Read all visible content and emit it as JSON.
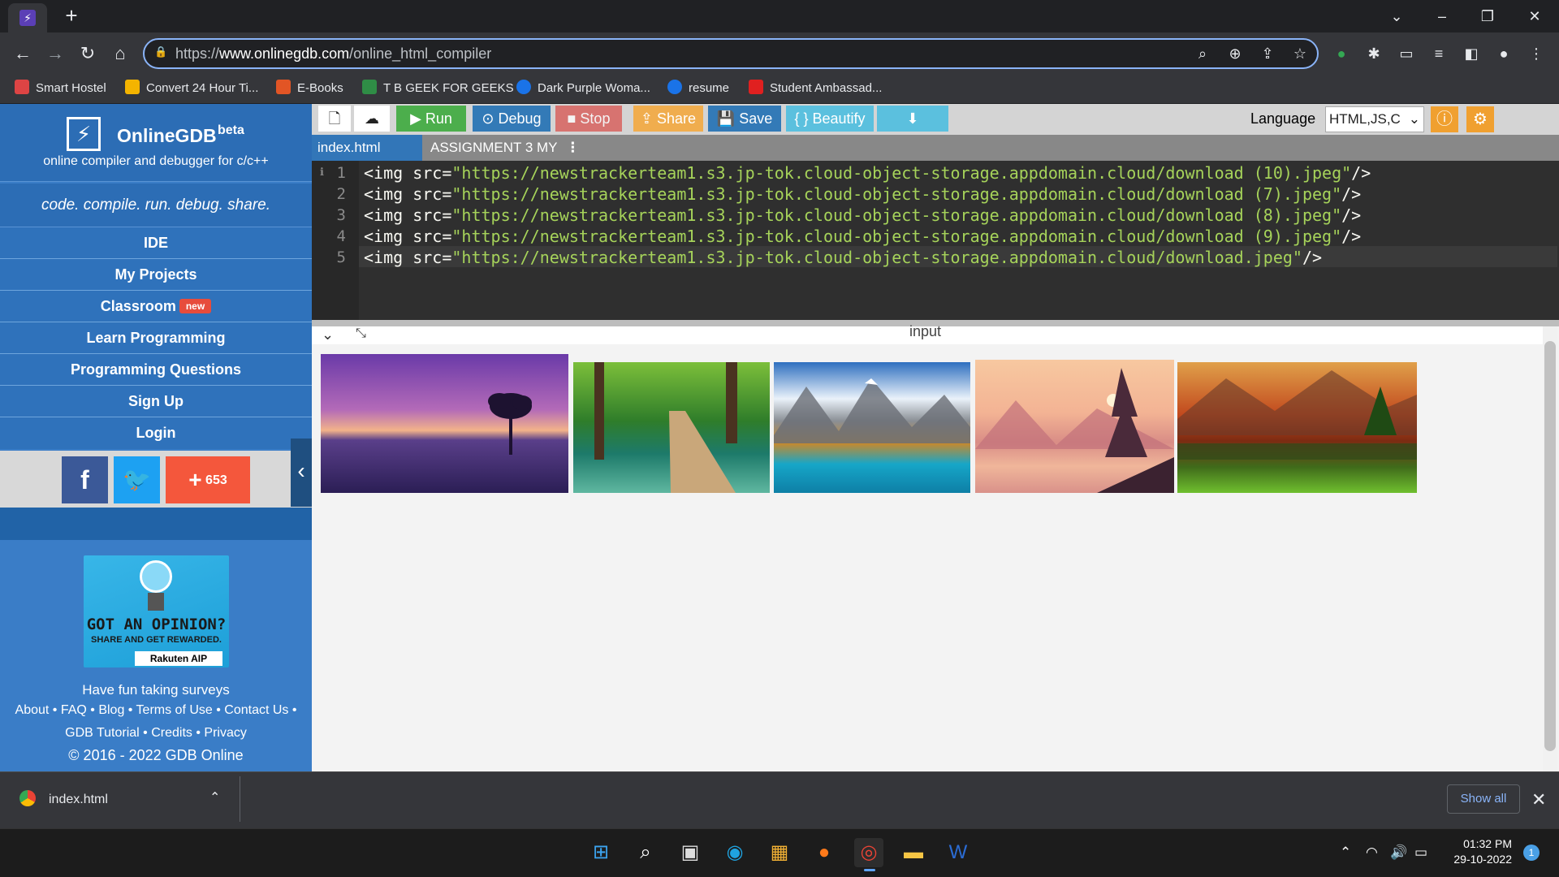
{
  "browser": {
    "url_prefix": "https://",
    "url_domain": "www.onlinegdb.com",
    "url_path": "/online_html_compiler",
    "bookmarks": [
      "Smart Hostel",
      "Convert 24 Hour Ti...",
      "E-Books",
      "T B GEEK FOR  GEEKS",
      "Dark Purple Woma...",
      "resume",
      "Student Ambassad..."
    ]
  },
  "sidebar": {
    "brand": "OnlineGDB",
    "beta": "beta",
    "subtitle": "online compiler and debugger for c/c++",
    "tagline": "code. compile. run. debug. share.",
    "nav": [
      "IDE",
      "My Projects",
      "Classroom",
      "Learn Programming",
      "Programming Questions",
      "Sign Up",
      "Login"
    ],
    "new_badge": "new",
    "share_count": "653",
    "ad": {
      "headline": "GOT AN OPINION?",
      "sub": "SHARE AND GET REWARDED.",
      "brand": "Rakuten AIP"
    },
    "ad_caption": "Have fun taking surveys",
    "footer_links1": "About • FAQ • Blog • Terms of Use • Contact Us •",
    "footer_links2": "GDB Tutorial • Credits • Privacy",
    "copyright": "© 2016 - 2022 GDB Online"
  },
  "toolbar": {
    "run": "Run",
    "debug": "Debug",
    "stop": "Stop",
    "share": "Share",
    "save": "Save",
    "beautify": "{ } Beautify",
    "language_label": "Language",
    "language_value": "HTML,JS,C"
  },
  "tabs": [
    "index.html",
    "ASSIGNMENT 3 MY"
  ],
  "code": {
    "lines": [
      {
        "n": "1",
        "tag": "<img ",
        "attr": "src=",
        "str": "\"https://newstrackerteam1.s3.jp-tok.cloud-object-storage.appdomain.cloud/download (10).jpeg\"",
        "end": "/>"
      },
      {
        "n": "2",
        "tag": "<img ",
        "attr": "src=",
        "str": "\"https://newstrackerteam1.s3.jp-tok.cloud-object-storage.appdomain.cloud/download (7).jpeg\"",
        "end": "/>"
      },
      {
        "n": "3",
        "tag": "<img ",
        "attr": "src=",
        "str": "\"https://newstrackerteam1.s3.jp-tok.cloud-object-storage.appdomain.cloud/download (8).jpeg\"",
        "end": "/>"
      },
      {
        "n": "4",
        "tag": "<img ",
        "attr": "src=",
        "str": "\"https://newstrackerteam1.s3.jp-tok.cloud-object-storage.appdomain.cloud/download (9).jpeg\"",
        "end": "/>"
      },
      {
        "n": "5",
        "tag": "<img ",
        "attr": "src=",
        "str": "\"https://newstrackerteam1.s3.jp-tok.cloud-object-storage.appdomain.cloud/download.jpeg\"",
        "end": "/>"
      }
    ]
  },
  "output": {
    "title": "input"
  },
  "download_bar": {
    "file": "index.html",
    "show_all": "Show all"
  },
  "taskbar": {
    "time": "01:32 PM",
    "date": "29-10-2022",
    "notifications": "1"
  }
}
